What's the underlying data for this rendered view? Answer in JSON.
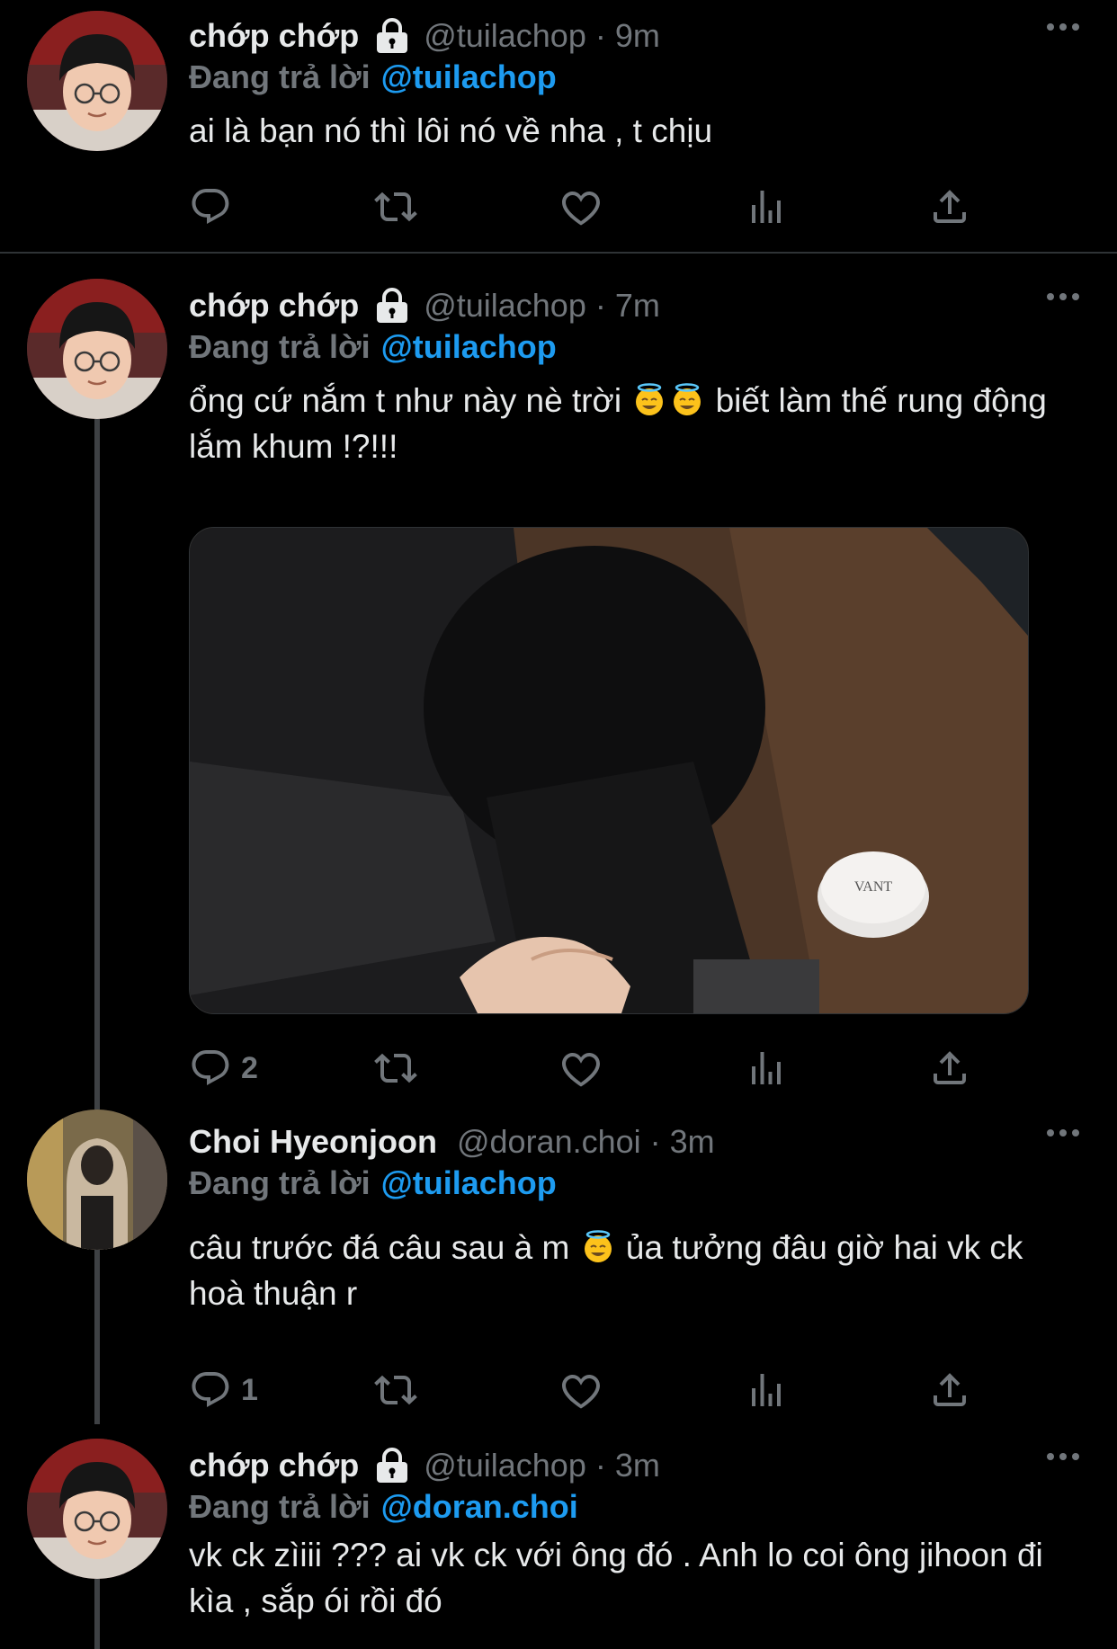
{
  "tweets": [
    {
      "name": "chớp chớp",
      "handle": "@tuilachop",
      "dot": "·",
      "time": "9m",
      "replying_label": "Đang trả lời",
      "replying_to": "@tuilachop",
      "text": "ai là bạn nó thì lôi nó về nha , t chịu",
      "reply_count": "",
      "locked": true
    },
    {
      "name": "chớp chớp",
      "handle": "@tuilachop",
      "dot": "·",
      "time": "7m",
      "replying_label": "Đang trả lời",
      "replying_to": "@tuilachop",
      "text_part1": "ổng cứ nắm t như này nè trời",
      "text_part2": " biết làm thế rung động lắm khum !?!!!",
      "reply_count": "2",
      "locked": true,
      "media_label": "VANT"
    },
    {
      "name": "Choi Hyeonjoon",
      "handle": "@doran.choi",
      "dot": "·",
      "time": "3m",
      "replying_label": "Đang trả lời",
      "replying_to": "@tuilachop",
      "text_part1": "câu trước đá câu sau à m",
      "text_part2": " ủa tưởng đâu giờ hai vk ck hoà thuận r",
      "reply_count": "1",
      "locked": false
    },
    {
      "name": "chớp chớp",
      "handle": "@tuilachop",
      "dot": "·",
      "time": "3m",
      "replying_label": "Đang trả lời",
      "replying_to": "@doran.choi",
      "text": "vk ck zìiii ??? ai vk ck với ông đó . Anh lo coi ông jihoon đi kìa , sắp ói rồi đó",
      "locked": true
    }
  ],
  "icons": {
    "reply": "reply-icon",
    "retweet": "retweet-icon",
    "like": "heart-icon",
    "views": "views-icon",
    "share": "share-icon",
    "more": "more-icon",
    "lock": "lock-icon",
    "emoji": "smiling-face-with-halo-emoji"
  },
  "colors": {
    "background": "#000000",
    "text": "#e7e9ea",
    "secondary": "#71767b",
    "link": "#1d9bf0",
    "divider": "#2f3336"
  }
}
